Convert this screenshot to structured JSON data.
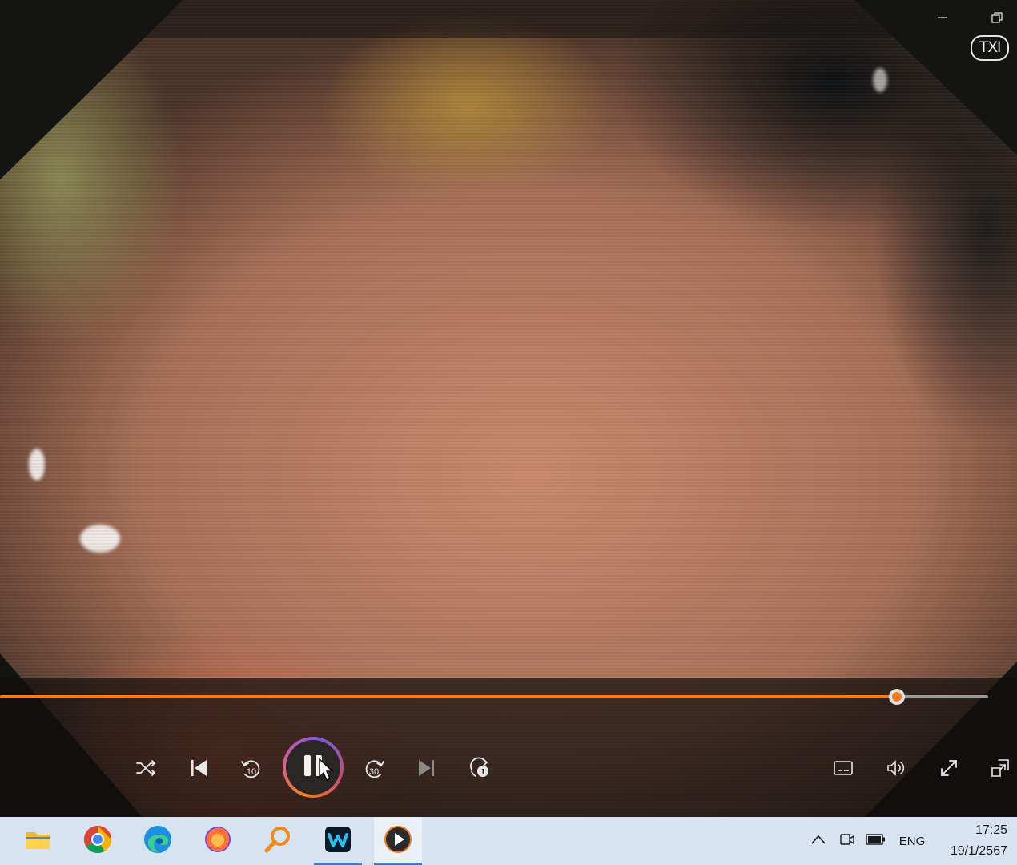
{
  "window": {
    "minimize_icon": "minimize-icon",
    "restore_icon": "restore-icon"
  },
  "video": {
    "overlay_badge": "TXI"
  },
  "player": {
    "progress": 0.908,
    "accent_color": "#ef7d22",
    "controls": {
      "shuffle_icon": "shuffle-icon",
      "previous_icon": "skip-previous-icon",
      "rewind_seconds": "10",
      "play_pause_state": "playing",
      "pause_icon": "pause-icon",
      "forward_seconds": "30",
      "next_icon": "skip-next-icon",
      "repeat_icon": "repeat-one-icon",
      "repeat_badge": "1",
      "subtitles_icon": "subtitles-icon",
      "volume_icon": "volume-icon",
      "fullscreen_icon": "fullscreen-icon",
      "miniplayer_icon": "miniplayer-icon"
    }
  },
  "taskbar": {
    "apps": [
      {
        "name": "File Explorer",
        "icon": "folder-icon",
        "running": false,
        "active": false
      },
      {
        "name": "Google Chrome",
        "icon": "chrome-icon",
        "running": false,
        "active": false
      },
      {
        "name": "Microsoft Edge",
        "icon": "edge-icon",
        "running": false,
        "active": false
      },
      {
        "name": "Firefox",
        "icon": "firefox-icon",
        "running": false,
        "active": false
      },
      {
        "name": "Search",
        "icon": "magnifier-icon",
        "running": false,
        "active": false
      },
      {
        "name": "Webex",
        "icon": "webex-icon",
        "running": true,
        "active": false
      },
      {
        "name": "Media Player",
        "icon": "media-player-icon",
        "running": true,
        "active": true
      }
    ],
    "tray": {
      "chevron_icon": "chevron-up-icon",
      "meet_icon": "meet-now-icon",
      "battery_icon": "battery-icon",
      "language": "ENG"
    },
    "clock": {
      "time": "17:25",
      "date": "19/1/2567"
    }
  }
}
